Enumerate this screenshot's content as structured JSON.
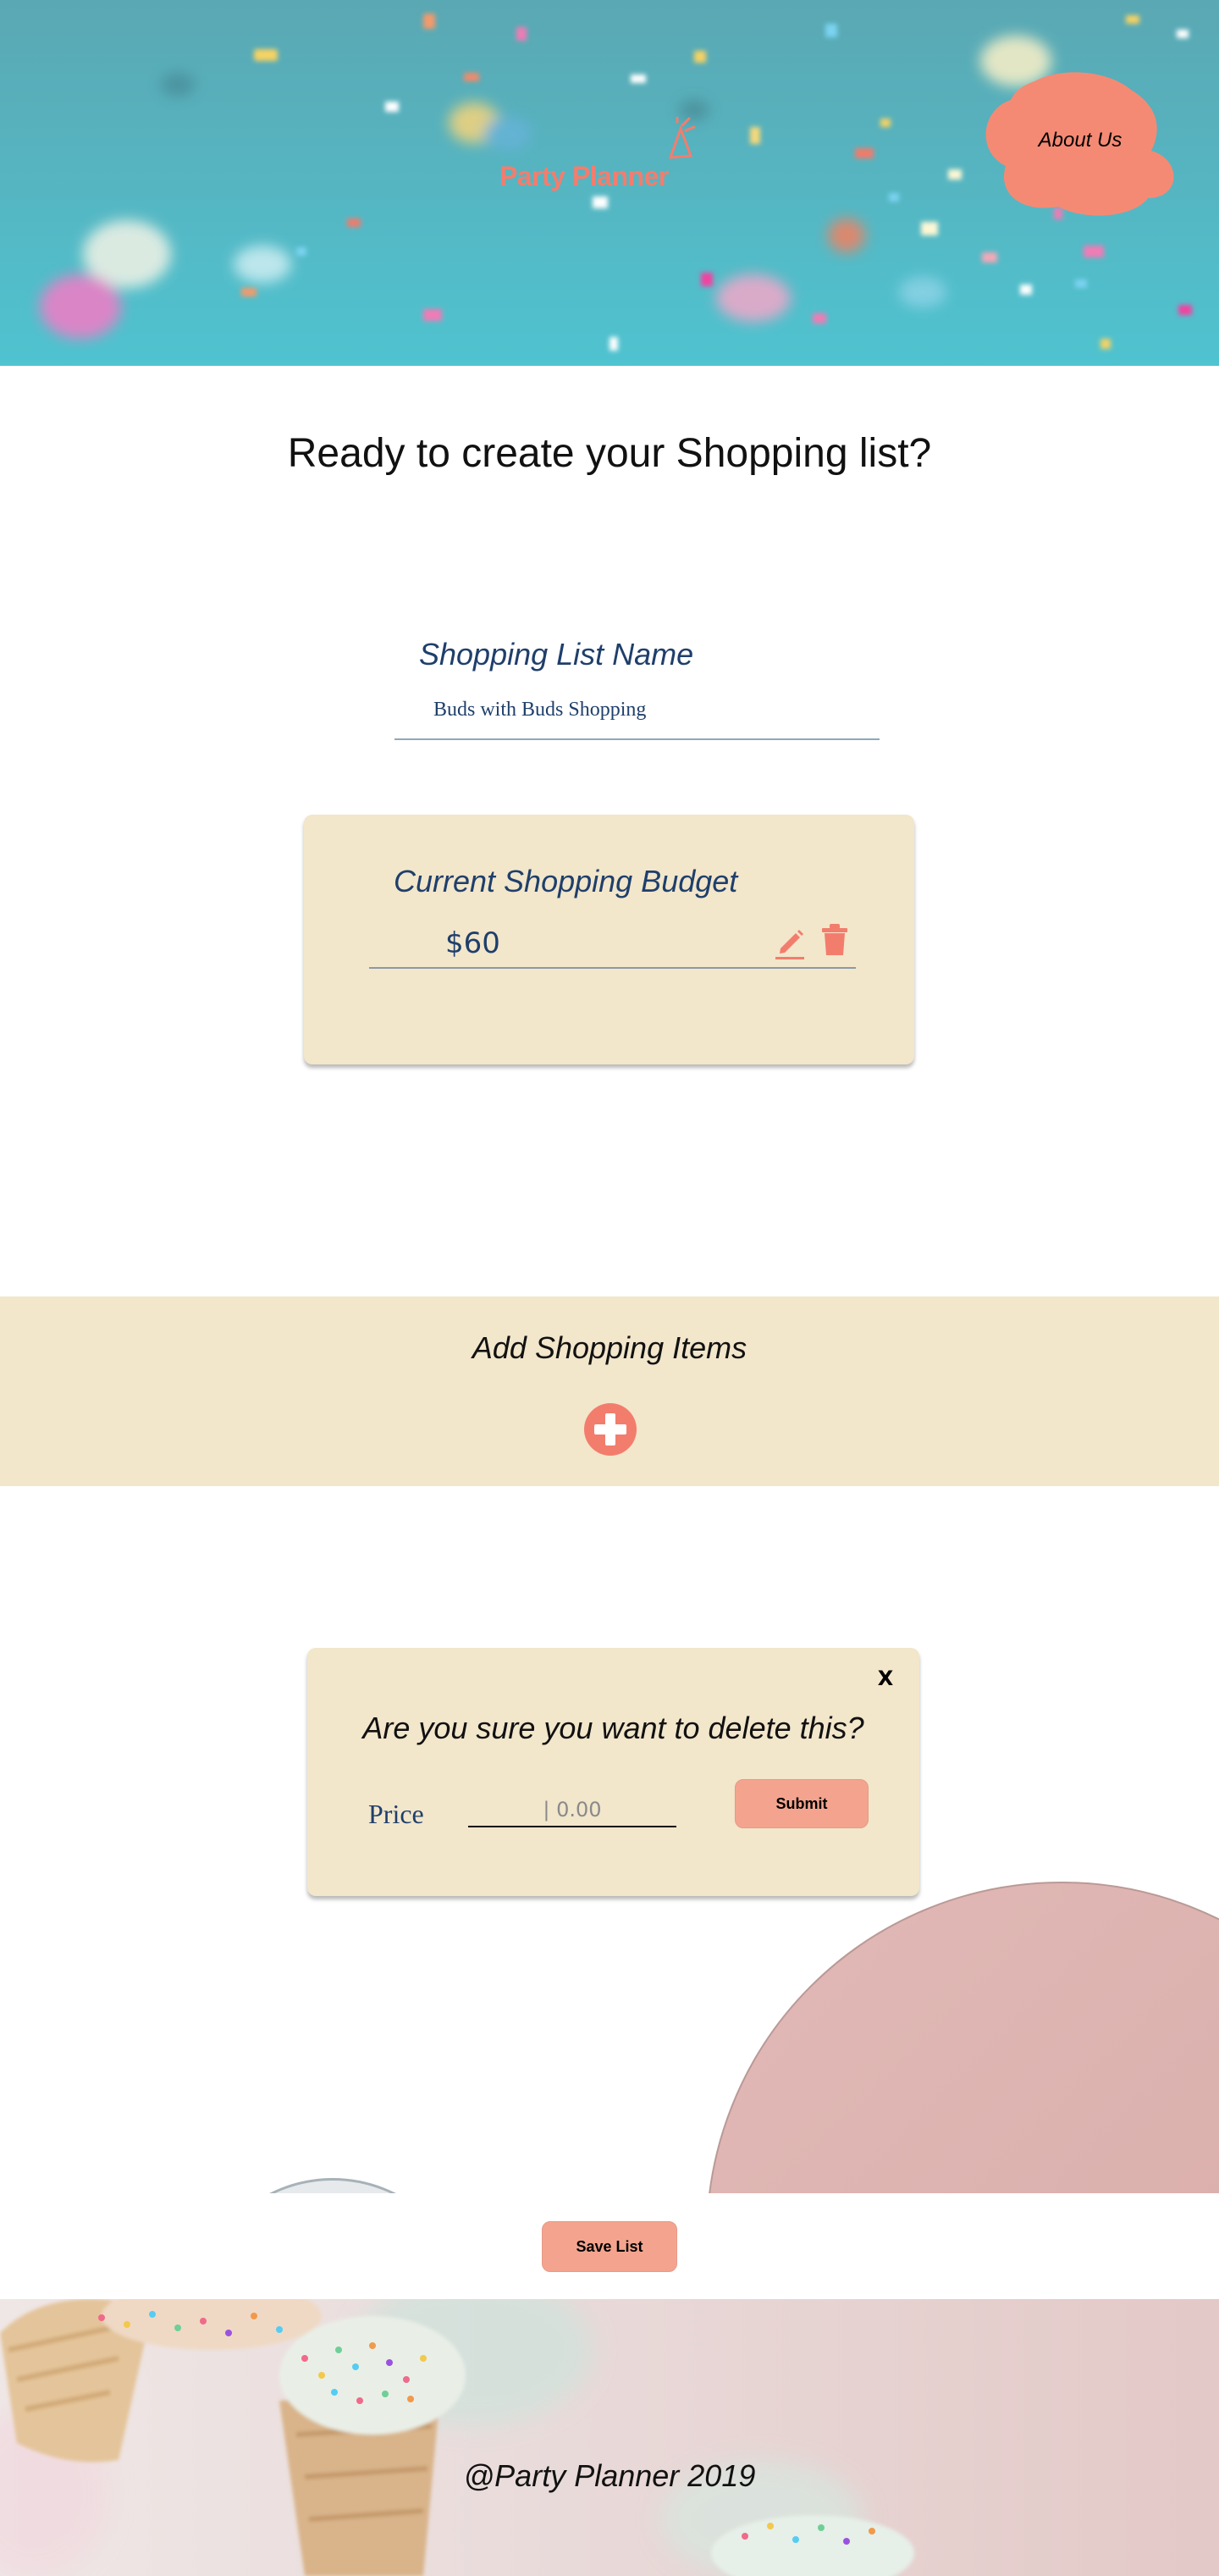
{
  "header": {
    "brand": "Party Planner",
    "about_link": "About Us",
    "accent_color": "#f37d6d"
  },
  "page": {
    "heading": "Ready to create your Shopping list?"
  },
  "list_name": {
    "label": "Shopping List Name",
    "value": "Buds with Buds Shopping"
  },
  "budget": {
    "title": "Current Shopping Budget",
    "value": "$60",
    "edit_icon": "pencil-icon",
    "delete_icon": "trash-icon"
  },
  "add_items": {
    "title": "Add Shopping Items",
    "icon": "plus-circle-icon"
  },
  "delete_dialog": {
    "close_label": "X",
    "message": "Are you sure you want to delete this?",
    "price_label": "Price",
    "price_placeholder": "| 0.00",
    "submit_label": "Submit"
  },
  "actions": {
    "save_label": "Save List"
  },
  "footer": {
    "text": "@Party Planner 2019"
  },
  "colors": {
    "panel": "#f2e6cb",
    "navy_text": "#1f3f6b",
    "button": "#f4a48e"
  }
}
